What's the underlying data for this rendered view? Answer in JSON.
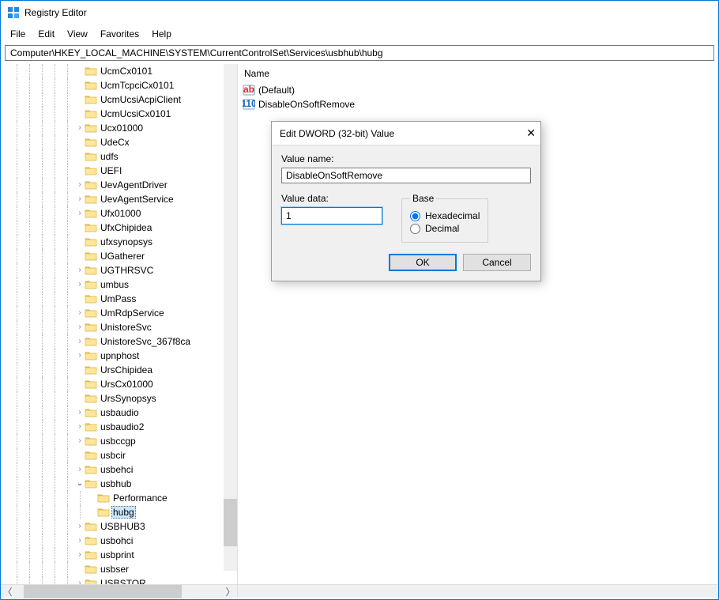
{
  "window": {
    "title": "Registry Editor"
  },
  "menu": {
    "file": "File",
    "edit": "Edit",
    "view": "View",
    "favorites": "Favorites",
    "help": "Help"
  },
  "address": "Computer\\HKEY_LOCAL_MACHINE\\SYSTEM\\CurrentControlSet\\Services\\usbhub\\hubg",
  "tree": {
    "items": [
      {
        "depth": 5,
        "exp": "",
        "label": "UcmCx0101"
      },
      {
        "depth": 5,
        "exp": "",
        "label": "UcmTcpciCx0101"
      },
      {
        "depth": 5,
        "exp": "",
        "label": "UcmUcsiAcpiClient"
      },
      {
        "depth": 5,
        "exp": "",
        "label": "UcmUcsiCx0101"
      },
      {
        "depth": 5,
        "exp": ">",
        "label": "Ucx01000"
      },
      {
        "depth": 5,
        "exp": "",
        "label": "UdeCx"
      },
      {
        "depth": 5,
        "exp": "",
        "label": "udfs"
      },
      {
        "depth": 5,
        "exp": "",
        "label": "UEFI"
      },
      {
        "depth": 5,
        "exp": ">",
        "label": "UevAgentDriver"
      },
      {
        "depth": 5,
        "exp": ">",
        "label": "UevAgentService"
      },
      {
        "depth": 5,
        "exp": ">",
        "label": "Ufx01000"
      },
      {
        "depth": 5,
        "exp": "",
        "label": "UfxChipidea"
      },
      {
        "depth": 5,
        "exp": "",
        "label": "ufxsynopsys"
      },
      {
        "depth": 5,
        "exp": "",
        "label": "UGatherer"
      },
      {
        "depth": 5,
        "exp": ">",
        "label": "UGTHRSVC"
      },
      {
        "depth": 5,
        "exp": ">",
        "label": "umbus"
      },
      {
        "depth": 5,
        "exp": "",
        "label": "UmPass"
      },
      {
        "depth": 5,
        "exp": ">",
        "label": "UmRdpService"
      },
      {
        "depth": 5,
        "exp": ">",
        "label": "UnistoreSvc"
      },
      {
        "depth": 5,
        "exp": ">",
        "label": "UnistoreSvc_367f8ca"
      },
      {
        "depth": 5,
        "exp": ">",
        "label": "upnphost"
      },
      {
        "depth": 5,
        "exp": "",
        "label": "UrsChipidea"
      },
      {
        "depth": 5,
        "exp": "",
        "label": "UrsCx01000"
      },
      {
        "depth": 5,
        "exp": "",
        "label": "UrsSynopsys"
      },
      {
        "depth": 5,
        "exp": ">",
        "label": "usbaudio"
      },
      {
        "depth": 5,
        "exp": ">",
        "label": "usbaudio2"
      },
      {
        "depth": 5,
        "exp": ">",
        "label": "usbccgp"
      },
      {
        "depth": 5,
        "exp": "",
        "label": "usbcir"
      },
      {
        "depth": 5,
        "exp": ">",
        "label": "usbehci"
      },
      {
        "depth": 5,
        "exp": "v",
        "label": "usbhub"
      },
      {
        "depth": 6,
        "exp": "",
        "label": "Performance"
      },
      {
        "depth": 6,
        "exp": "",
        "label": "hubg",
        "selected": true
      },
      {
        "depth": 5,
        "exp": ">",
        "label": "USBHUB3"
      },
      {
        "depth": 5,
        "exp": ">",
        "label": "usbohci"
      },
      {
        "depth": 5,
        "exp": ">",
        "label": "usbprint"
      },
      {
        "depth": 5,
        "exp": "",
        "label": "usbser"
      },
      {
        "depth": 5,
        "exp": ">",
        "label": "USBSTOR"
      }
    ]
  },
  "list": {
    "header": "Name",
    "rows": [
      {
        "icon": "ab",
        "label": "(Default)"
      },
      {
        "icon": "110",
        "label": "DisableOnSoftRemove"
      }
    ]
  },
  "dialog": {
    "title": "Edit DWORD (32-bit) Value",
    "valueNameLabel": "Value name:",
    "valueName": "DisableOnSoftRemove",
    "valueDataLabel": "Value data:",
    "valueData": "1",
    "baseLabel": "Base",
    "hex": "Hexadecimal",
    "dec": "Decimal",
    "ok": "OK",
    "cancel": "Cancel"
  }
}
